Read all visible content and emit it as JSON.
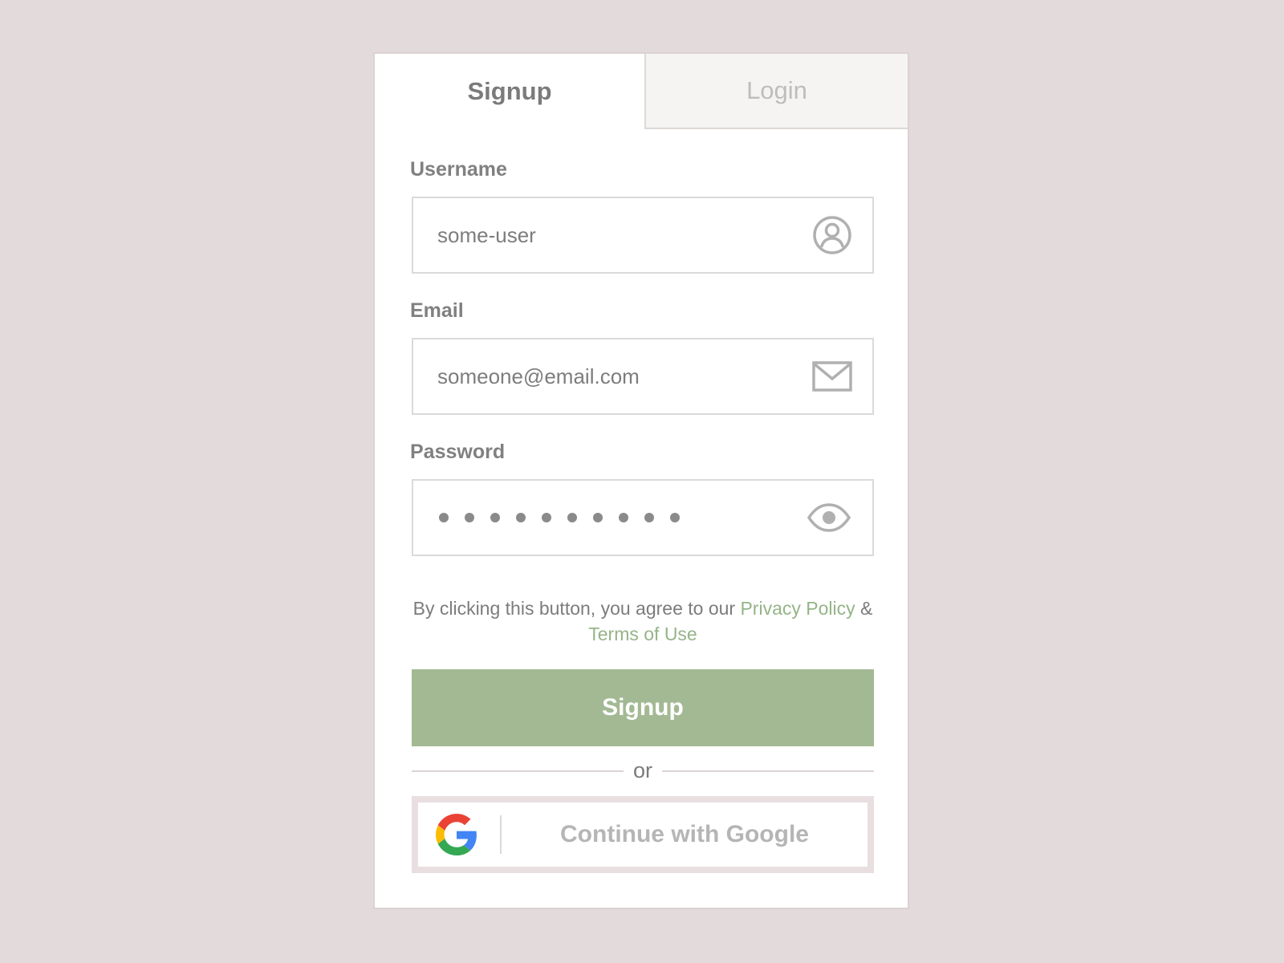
{
  "tabs": {
    "signup": "Signup",
    "login": "Login"
  },
  "form": {
    "username": {
      "label": "Username",
      "value": "some-user",
      "icon": "user-circle-icon"
    },
    "email": {
      "label": "Email",
      "value": "someone@email.com",
      "icon": "envelope-icon"
    },
    "password": {
      "label": "Password",
      "masked_length": 10,
      "icon": "eye-icon"
    }
  },
  "agreement": {
    "prefix": "By clicking this button, you agree to our ",
    "privacy_link": "Privacy Policy",
    "joiner": " & ",
    "terms_link": "Terms of Use"
  },
  "signup_button": "Signup",
  "divider_text": "or",
  "google_button": {
    "label": "Continue with Google",
    "icon": "google-logo-icon"
  },
  "colors": {
    "background": "#e3dadb",
    "accent": "#a3b994",
    "link": "#95b488"
  }
}
